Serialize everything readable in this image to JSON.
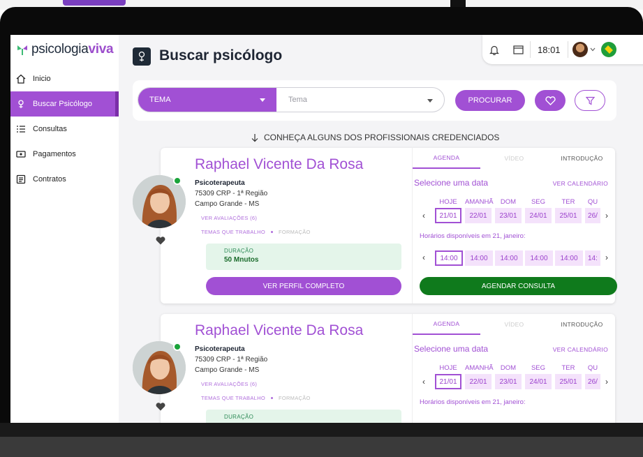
{
  "brand": {
    "logo_text_plain": "psicologia",
    "logo_text_bold": "viva"
  },
  "sidebar": {
    "items": [
      {
        "label": "Inicio",
        "icon": "home-icon"
      },
      {
        "label": "Buscar Psicólogo",
        "icon": "psychologist-icon",
        "active": true
      },
      {
        "label": "Consultas",
        "icon": "list-icon"
      },
      {
        "label": "Pagamentos",
        "icon": "payment-icon"
      },
      {
        "label": "Contratos",
        "icon": "contract-icon"
      }
    ]
  },
  "header": {
    "title": "Buscar psicólogo",
    "time": "18:01"
  },
  "search": {
    "tema_label": "TEMA",
    "tema_placeholder": "Tema",
    "procurar_label": "PROCURAR"
  },
  "section_caption": "CONHEÇA ALGUNS DOS PROFISSIONAIS CREDENCIADOS",
  "cards": [
    {
      "name": "Raphael Vicente Da Rosa",
      "role": "Psicoterapeuta",
      "crp": "75309 CRP - 1ª Região",
      "city": "Campo Grande - MS",
      "reviews_link": "VER AVALIAÇÕES (6)",
      "themes_link": "TEMAS QUE TRABALHO",
      "formation_link": "FORMAÇÃO",
      "duration_label": "DURAÇÃO",
      "duration_value": "50 Mnutos",
      "profile_button": "VER PERFIL COMPLETO",
      "tabs": [
        "AGENDA",
        "VÍDEO",
        "INTRODUÇÃO"
      ],
      "select_date": "Selecione uma data",
      "calendar_link": "VER CALENDÁRIO",
      "days": [
        {
          "label": "HOJE",
          "date": "21/01"
        },
        {
          "label": "AMANHÃ",
          "date": "22/01"
        },
        {
          "label": "DOM",
          "date": "23/01"
        },
        {
          "label": "SEG",
          "date": "24/01"
        },
        {
          "label": "TER",
          "date": "25/01"
        },
        {
          "label": "QU",
          "date": "26/"
        }
      ],
      "hours_caption": "Horários disponíveis em 21, janeiro:",
      "hours": [
        "14:00",
        "14:00",
        "14:00",
        "14:00",
        "14:00",
        "14:"
      ],
      "schedule_button": "AGENDAR CONSULTA"
    },
    {
      "name": "Raphael Vicente Da Rosa",
      "role": "Psicoterapeuta",
      "crp": "75309 CRP - 1ª Região",
      "city": "Campo Grande - MS",
      "reviews_link": "VER AVALIAÇÕES (6)",
      "themes_link": "TEMAS QUE TRABALHO",
      "formation_link": "FORMAÇÃO",
      "duration_label": "DURAÇÃO",
      "tabs": [
        "AGENDA",
        "VÍDEO",
        "INTRODUÇÃO"
      ],
      "select_date": "Selecione uma data",
      "calendar_link": "VER CALENDÁRIO",
      "days": [
        {
          "label": "HOJE",
          "date": "21/01"
        },
        {
          "label": "AMANHÃ",
          "date": "22/01"
        },
        {
          "label": "DOM",
          "date": "23/01"
        },
        {
          "label": "SEG",
          "date": "24/01"
        },
        {
          "label": "TER",
          "date": "25/01"
        },
        {
          "label": "QU",
          "date": "26/"
        }
      ],
      "hours_caption": "Horários disponíveis em 21, janeiro:"
    }
  ],
  "colors": {
    "accent": "#a150d4",
    "green": "#0f7a1c",
    "dark": "#1e2533"
  }
}
